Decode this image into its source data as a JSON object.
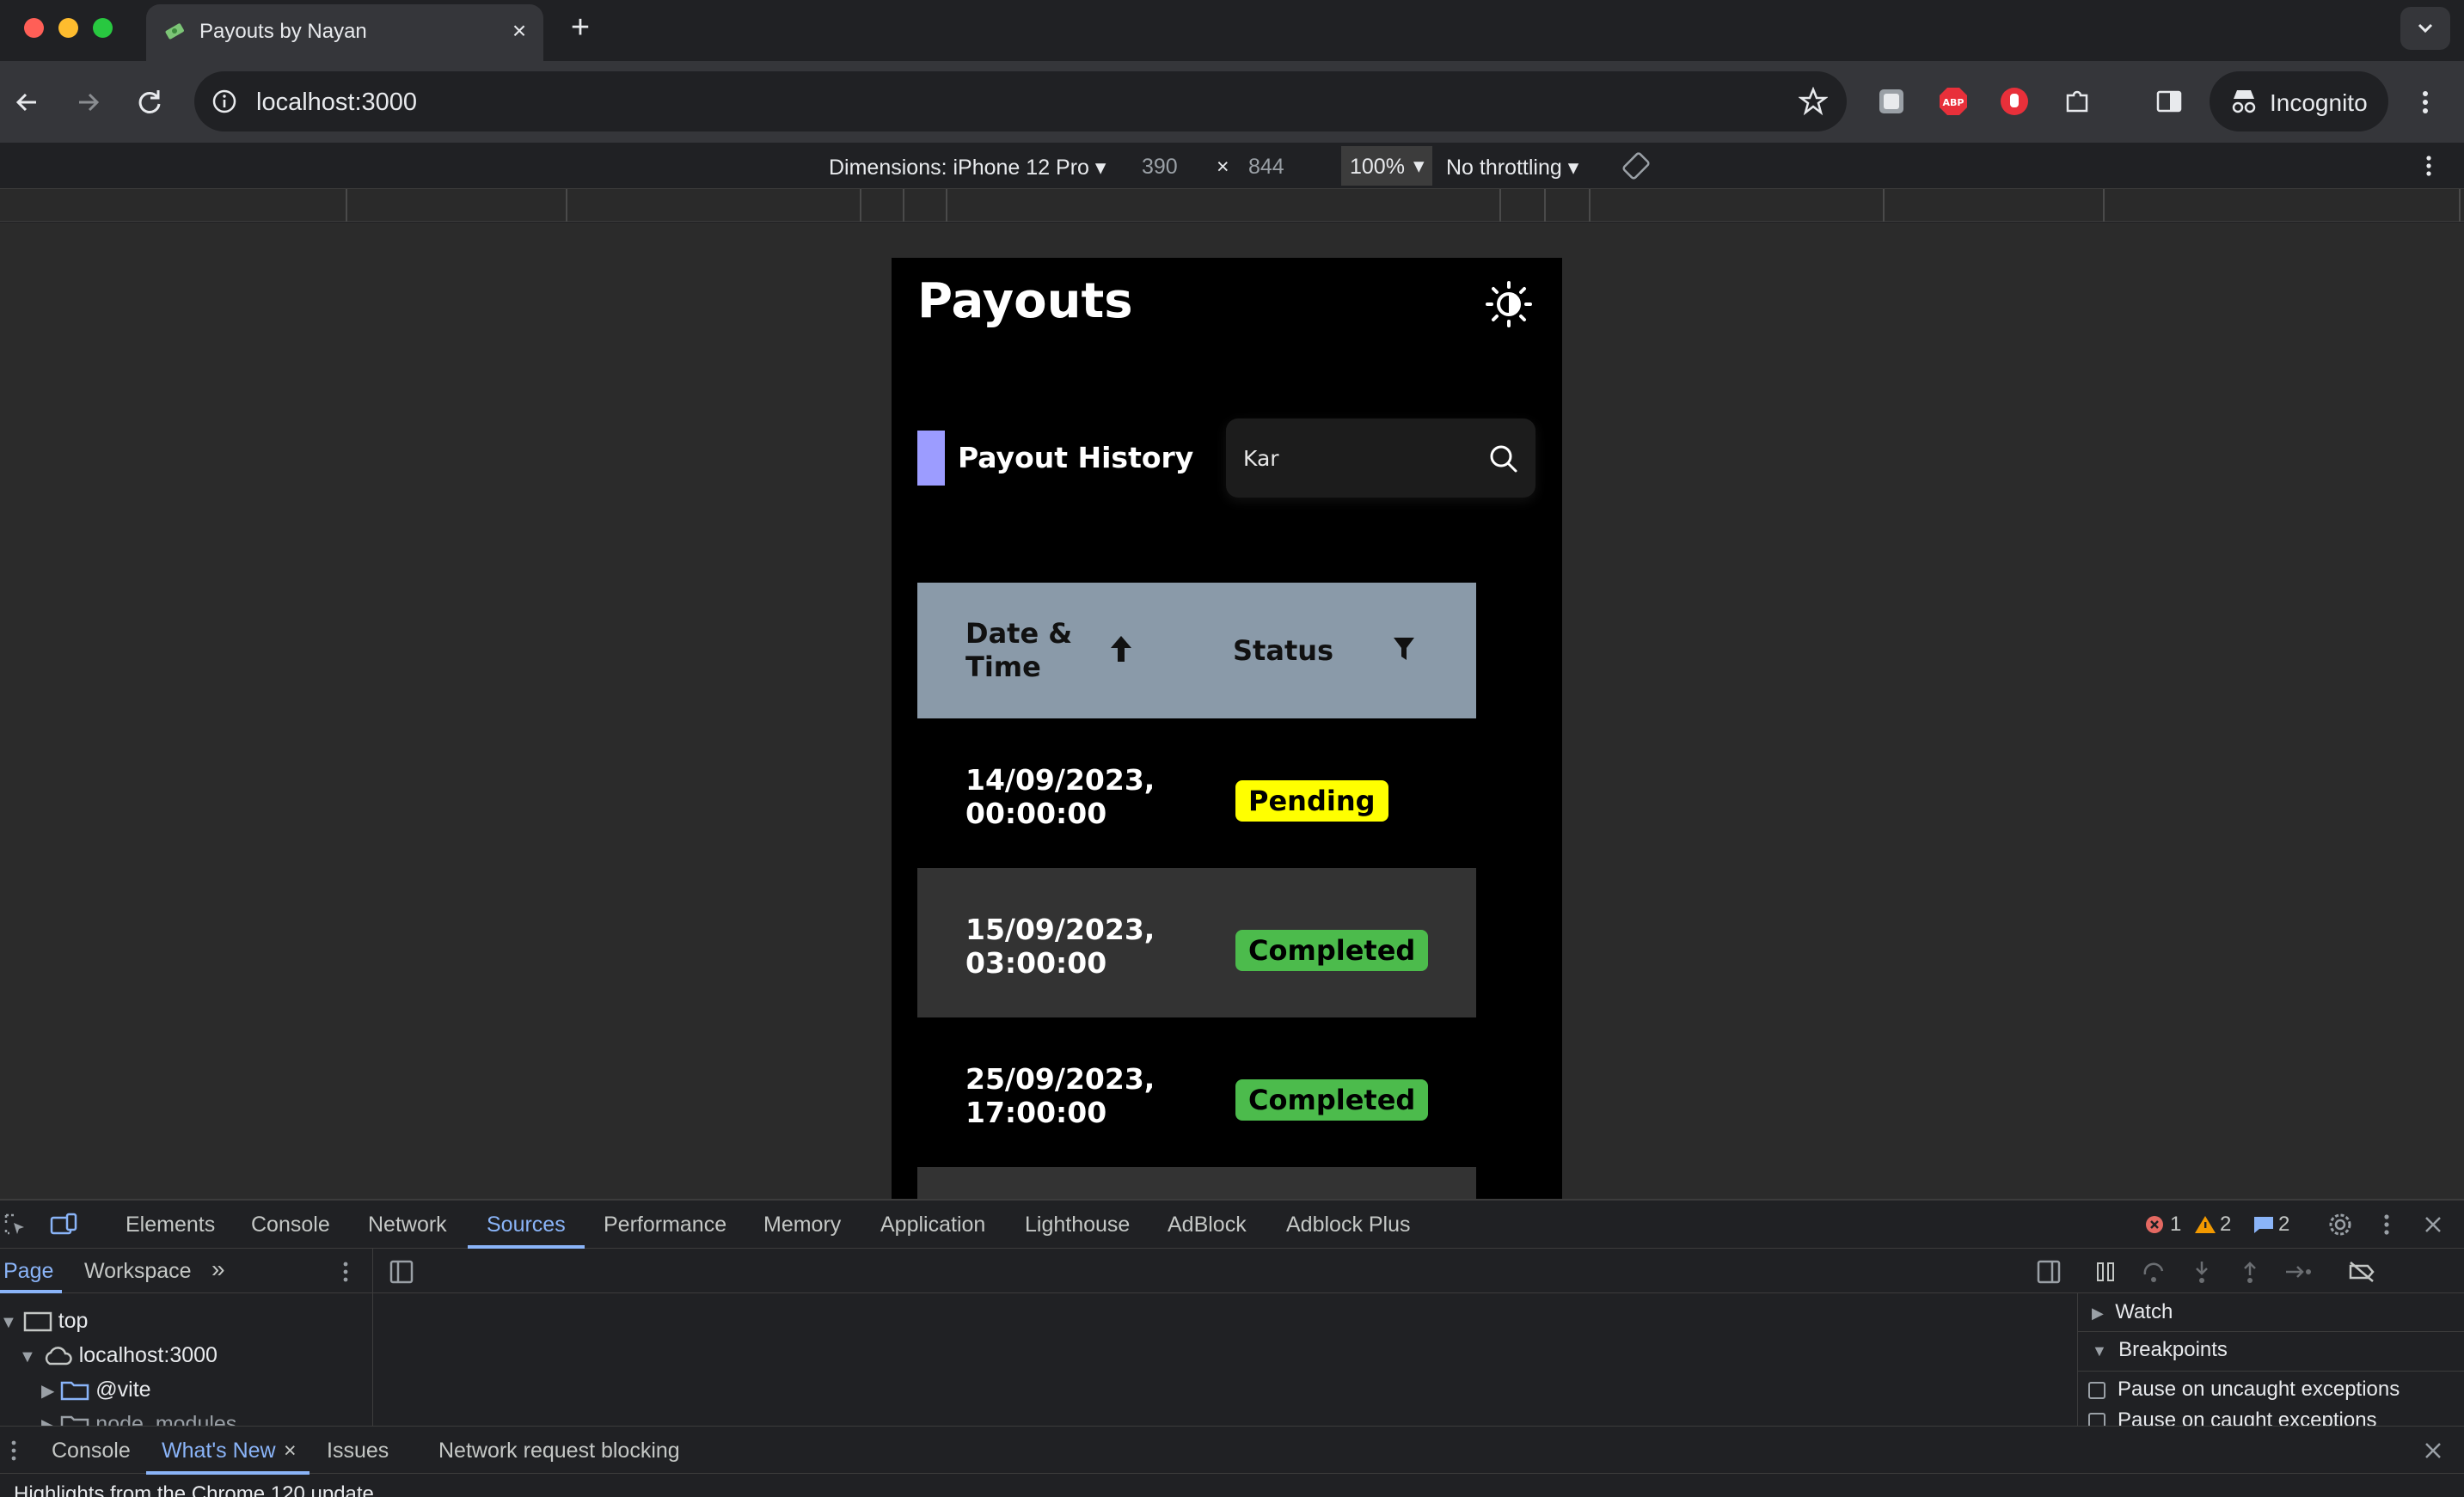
{
  "browser": {
    "tab_title": "Payouts by Nayan",
    "url": "localhost:3000",
    "incognito_label": "Incognito"
  },
  "device_toolbar": {
    "dimensions_label": "Dimensions: iPhone 12 Pro",
    "width": "390",
    "times": "×",
    "height": "844",
    "zoom": "100%",
    "throttling": "No throttling"
  },
  "app": {
    "title": "Payouts",
    "section_title": "Payout History",
    "search": {
      "value": "Kar",
      "placeholder": "Search"
    },
    "table": {
      "headers": {
        "date": "Date & Time",
        "status": "Status"
      },
      "rows": [
        {
          "date": "14/09/2023,\n00:00:00",
          "status": "Pending"
        },
        {
          "date": "15/09/2023,\n03:00:00",
          "status": "Completed"
        },
        {
          "date": "25/09/2023,\n17:00:00",
          "status": "Completed"
        }
      ]
    },
    "colors": {
      "accent": "#9c9cff",
      "header_bg": "#8a9aa9",
      "pending": "#ffff00",
      "completed": "#4cbb4c"
    }
  },
  "devtools": {
    "tabs": [
      "Elements",
      "Console",
      "Network",
      "Sources",
      "Performance",
      "Memory",
      "Application",
      "Lighthouse",
      "AdBlock",
      "Adblock Plus"
    ],
    "active_tab": "Sources",
    "errors": "1",
    "warnings": "2",
    "messages": "2",
    "sub_tabs": {
      "page": "Page",
      "workspace": "Workspace"
    },
    "tree": {
      "top": "top",
      "host": "localhost:3000",
      "vite": "@vite",
      "node_modules": "node_modules"
    },
    "debugger": {
      "watch": "Watch",
      "breakpoints": "Breakpoints",
      "pause_uncaught": "Pause on uncaught exceptions",
      "pause_caught": "Pause on caught exceptions"
    },
    "drawer_tabs": {
      "console": "Console",
      "whats_new": "What's New",
      "issues": "Issues",
      "network_blocking": "Network request blocking"
    },
    "whats_new_text": "Highlights from the Chrome 120 update"
  }
}
